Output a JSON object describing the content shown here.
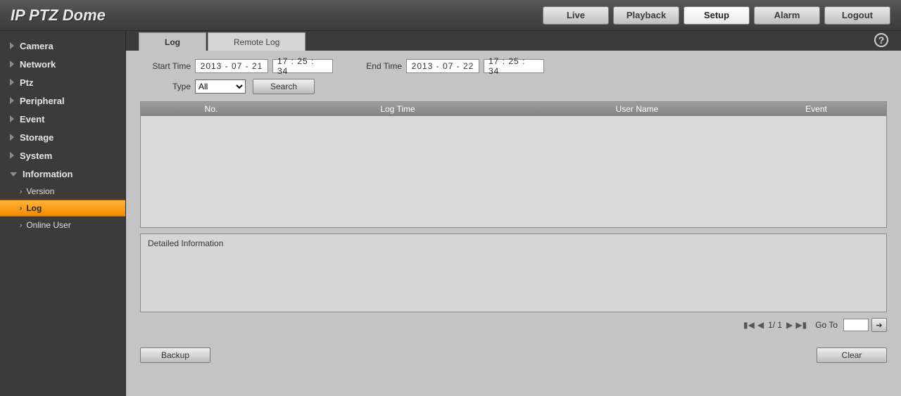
{
  "brand": "IP PTZ Dome",
  "top_nav": {
    "live": "Live",
    "playback": "Playback",
    "setup": "Setup",
    "alarm": "Alarm",
    "logout": "Logout"
  },
  "sidebar": {
    "items": [
      {
        "label": "Camera",
        "expanded": false
      },
      {
        "label": "Network",
        "expanded": false
      },
      {
        "label": "Ptz",
        "expanded": false
      },
      {
        "label": "Peripheral",
        "expanded": false
      },
      {
        "label": "Event",
        "expanded": false
      },
      {
        "label": "Storage",
        "expanded": false
      },
      {
        "label": "System",
        "expanded": false
      },
      {
        "label": "Information",
        "expanded": true
      }
    ],
    "info_children": [
      {
        "label": "Version",
        "active": false
      },
      {
        "label": "Log",
        "active": true
      },
      {
        "label": "Online User",
        "active": false
      }
    ]
  },
  "tabs": {
    "log": "Log",
    "remote_log": "Remote Log"
  },
  "filters": {
    "start_label": "Start Time",
    "start_date": "2013 - 07 - 21",
    "start_time": "17 : 25 : 34",
    "end_label": "End Time",
    "end_date": "2013 - 07 - 22",
    "end_time": "17 : 25 : 34",
    "type_label": "Type",
    "type_value": "All",
    "search_btn": "Search"
  },
  "table": {
    "col_no": "No.",
    "col_time": "Log Time",
    "col_user": "User Name",
    "col_event": "Event"
  },
  "detail_title": "Detailed Information",
  "pager": {
    "count": "1/ 1",
    "goto_label": "Go To",
    "goto_value": ""
  },
  "buttons": {
    "backup": "Backup",
    "clear": "Clear"
  },
  "help_glyph": "?"
}
